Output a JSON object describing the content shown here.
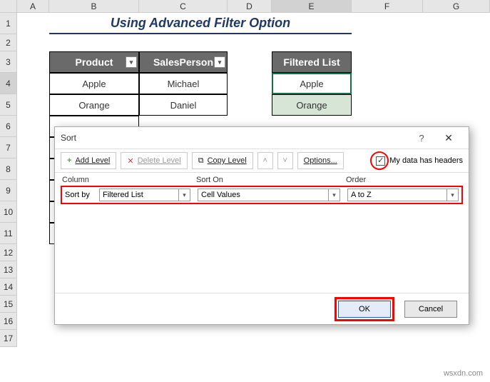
{
  "cols": [
    "A",
    "B",
    "C",
    "D",
    "E",
    "F",
    "G"
  ],
  "rows": [
    "1",
    "2",
    "3",
    "4",
    "5",
    "6",
    "7",
    "8",
    "9",
    "10",
    "11",
    "12",
    "13",
    "14",
    "15",
    "16",
    "17"
  ],
  "title": "Using Advanced Filter Option",
  "headers": {
    "product": "Product",
    "sales": "SalesPerson",
    "filtered": "Filtered List"
  },
  "cells": {
    "b4": "Apple",
    "c4": "Michael",
    "e4": "Apple",
    "b5": "Orange",
    "c5": "Daniel",
    "e5": "Orange"
  },
  "dialog": {
    "title": "Sort",
    "help": "?",
    "close": "✕",
    "add": "Add Level",
    "delete": "Delete Level",
    "copy": "Copy Level",
    "options": "Options...",
    "check_label": "My data has headers",
    "col_hdr": "Column",
    "sorton_hdr": "Sort On",
    "order_hdr": "Order",
    "sortby": "Sort by",
    "field": "Filtered List",
    "sorton": "Cell Values",
    "order": "A to Z",
    "ok": "OK",
    "cancel": "Cancel"
  },
  "watermark": "wsxdn.com"
}
